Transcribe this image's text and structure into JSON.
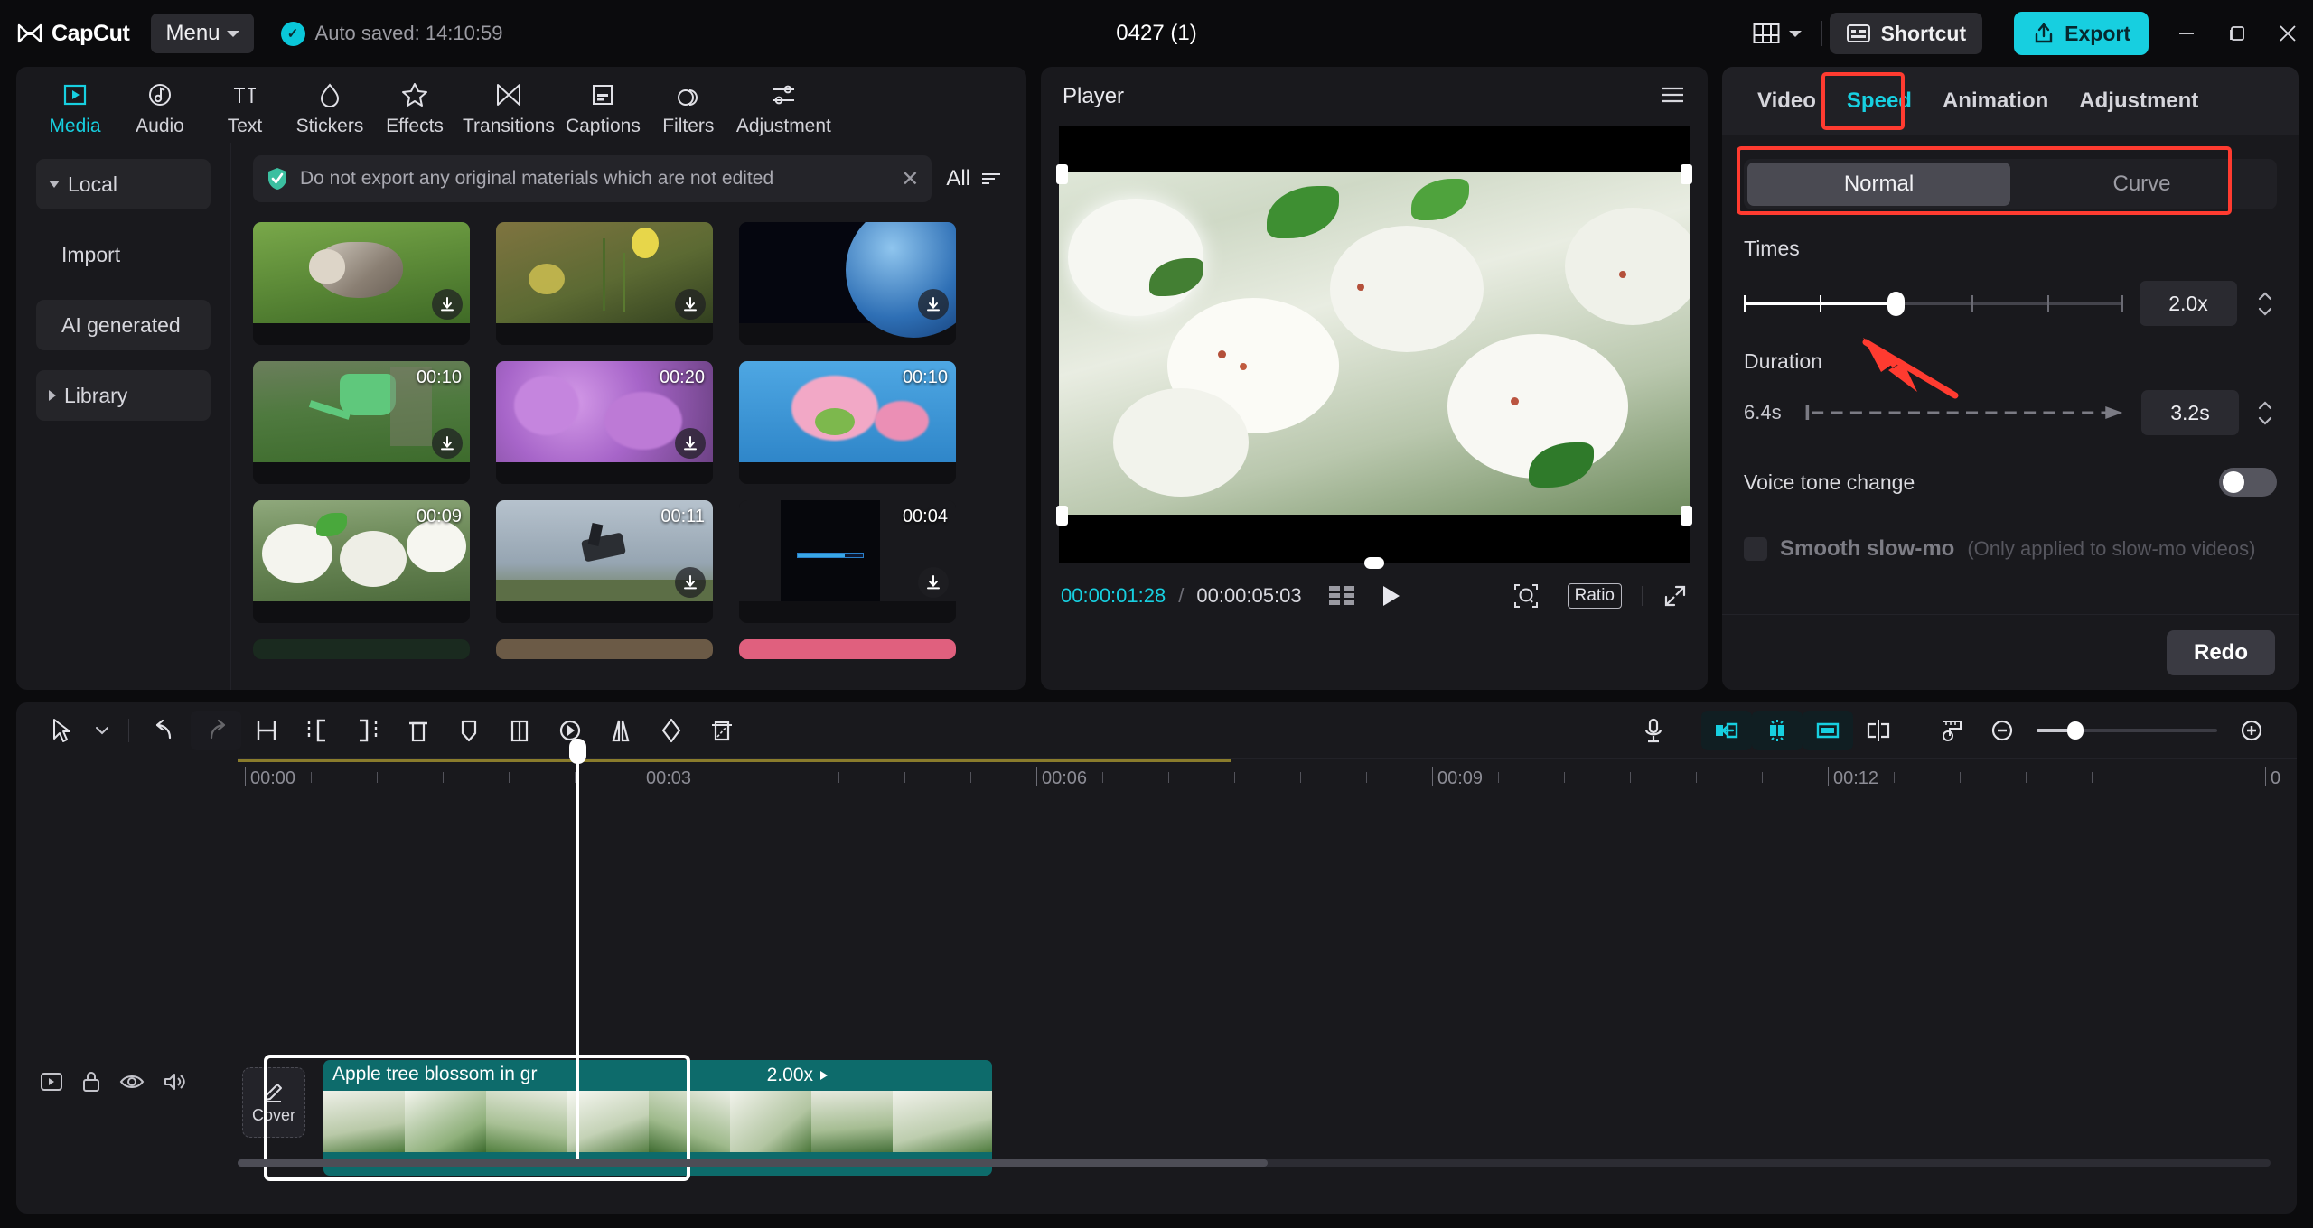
{
  "titlebar": {
    "app_name": "CapCut",
    "menu_label": "Menu",
    "autosave_text": "Auto saved: 14:10:59",
    "project_title": "0427 (1)",
    "shortcut_label": "Shortcut",
    "export_label": "Export",
    "minimize": "–",
    "maximize": "❐",
    "close": "✕"
  },
  "nav": {
    "items": [
      {
        "label": "Media",
        "icon": "media-icon",
        "active": true
      },
      {
        "label": "Audio",
        "icon": "audio-icon",
        "active": false
      },
      {
        "label": "Text",
        "icon": "text-icon",
        "active": false
      },
      {
        "label": "Stickers",
        "icon": "stickers-icon",
        "active": false
      },
      {
        "label": "Effects",
        "icon": "effects-icon",
        "active": false
      },
      {
        "label": "Transitions",
        "icon": "transitions-icon",
        "active": false
      },
      {
        "label": "Captions",
        "icon": "captions-icon",
        "active": false
      },
      {
        "label": "Filters",
        "icon": "filters-icon",
        "active": false
      },
      {
        "label": "Adjustment",
        "icon": "adjustment-icon",
        "active": false
      }
    ]
  },
  "sidebar": {
    "items": [
      {
        "label": "Local",
        "expand": "down"
      },
      {
        "label": "Import",
        "expand": "none"
      },
      {
        "label": "AI generated",
        "expand": "none"
      },
      {
        "label": "Library",
        "expand": "right"
      }
    ]
  },
  "media": {
    "notice_text": "Do not export any original materials which are not edited",
    "close_icon": "close-icon",
    "filter_label": "All",
    "cells": [
      {
        "name": "kitten-in-grass",
        "duration": "",
        "downloadable": true,
        "c1": "#6f9e3f",
        "c2": "#9fc46a",
        "c3": "#49702a"
      },
      {
        "name": "yellow-daffodils",
        "duration": "",
        "downloadable": true,
        "c1": "#8b7b3a",
        "c2": "#d8cf5c",
        "c3": "#4b5a2a"
      },
      {
        "name": "earth-from-space",
        "duration": "",
        "downloadable": true,
        "c1": "#0a1430",
        "c2": "#3f79c4",
        "c3": "#050a1b"
      },
      {
        "name": "watering-can",
        "duration": "00:10",
        "downloadable": true,
        "c1": "#6d8f4e",
        "c2": "#57b06a",
        "c3": "#3c5b33"
      },
      {
        "name": "purple-lilac",
        "duration": "00:20",
        "downloadable": true,
        "c1": "#a76fc5",
        "c2": "#c98fe0",
        "c3": "#6f4486"
      },
      {
        "name": "pink-cherry-blossom",
        "duration": "00:10",
        "downloadable": false,
        "c1": "#4da3df",
        "c2": "#f0a0c0",
        "c3": "#2c7bbd"
      },
      {
        "name": "white-apple-blossom",
        "duration": "00:09",
        "downloadable": false,
        "c1": "#d9e2cf",
        "c2": "#ffffff",
        "c3": "#5d7a47"
      },
      {
        "name": "motocross-jump",
        "duration": "00:11",
        "downloadable": true,
        "c1": "#a9b6c3",
        "c2": "#d5dde4",
        "c3": "#5d7050"
      },
      {
        "name": "now-loading-clip",
        "duration": "00:04",
        "downloadable": true,
        "c1": "#0a0a0e",
        "c2": "#12203a",
        "c3": "#05050a"
      }
    ]
  },
  "player": {
    "title": "Player",
    "menu_icon": "hamburger-icon",
    "current_time": "00:00:01:28",
    "separator": "/",
    "total_time": "00:00:05:03",
    "frames_icon": "frames-icon",
    "play_icon": "play-icon",
    "magnify_icon": "magnifier-icon",
    "ratio_label": "Ratio",
    "fullscreen_icon": "fullscreen-icon"
  },
  "right_panel": {
    "tabs": [
      {
        "label": "Video",
        "active": false
      },
      {
        "label": "Speed",
        "active": true
      },
      {
        "label": "Animation",
        "active": false
      },
      {
        "label": "Adjustment",
        "active": false
      }
    ],
    "mode": {
      "options": [
        "Normal",
        "Curve"
      ],
      "selected": "Normal"
    },
    "times": {
      "label": "Times",
      "value": "2.0x",
      "slider_percent": 40,
      "tick_percents": [
        0,
        20,
        40,
        60,
        80,
        100
      ],
      "spinner_icon": "spinner-icon"
    },
    "duration": {
      "label": "Duration",
      "original": "6.4s",
      "value": "3.2s",
      "spinner_icon": "spinner-icon"
    },
    "voice_tone": {
      "label": "Voice tone change",
      "enabled": false
    },
    "smooth_slowmo": {
      "label": "Smooth slow-mo",
      "hint": "(Only applied to slow-mo videos)",
      "checked": false,
      "disabled": true
    },
    "redo_label": "Redo"
  },
  "timeline": {
    "tools_left": [
      {
        "name": "select-arrow-icon",
        "state": "normal"
      },
      {
        "name": "tool-dropdown-caret-icon",
        "state": "normal"
      },
      {
        "name": "undo-icon",
        "state": "normal"
      },
      {
        "name": "redo-icon",
        "state": "dim"
      },
      {
        "name": "split-icon",
        "state": "normal"
      },
      {
        "name": "trim-left-icon",
        "state": "normal"
      },
      {
        "name": "trim-right-icon",
        "state": "normal"
      },
      {
        "name": "delete-icon",
        "state": "normal"
      },
      {
        "name": "marker-icon",
        "state": "normal"
      },
      {
        "name": "freeze-frame-icon",
        "state": "normal"
      },
      {
        "name": "reverse-icon",
        "state": "normal"
      },
      {
        "name": "mirror-icon",
        "state": "normal"
      },
      {
        "name": "rotate-icon",
        "state": "normal"
      },
      {
        "name": "crop-icon",
        "state": "normal"
      }
    ],
    "tools_right": [
      {
        "name": "microphone-icon",
        "state": "normal"
      },
      {
        "name": "snap-left-icon",
        "state": "teal"
      },
      {
        "name": "auto-snap-icon",
        "state": "teal-active"
      },
      {
        "name": "snap-right-icon",
        "state": "teal"
      },
      {
        "name": "link-clips-icon",
        "state": "normal"
      },
      {
        "name": "ruler-adjust-icon",
        "state": "normal"
      },
      {
        "name": "zoom-out-icon",
        "state": "normal"
      },
      {
        "name": "zoom-in-icon",
        "state": "normal"
      }
    ],
    "ruler_labels": [
      "00:00",
      "00:03",
      "00:06",
      "00:09",
      "00:12",
      "0"
    ],
    "track_controls": [
      {
        "name": "track-preview-icon"
      },
      {
        "name": "track-lock-icon"
      },
      {
        "name": "track-visibility-icon"
      },
      {
        "name": "track-volume-icon"
      }
    ],
    "cover_label": "Cover",
    "cover_icon": "pencil-icon",
    "clip": {
      "name": "Apple tree blossom in gr",
      "speed_badge": "2.00x",
      "selected": true
    },
    "playhead_time": "00:00:01:28"
  }
}
